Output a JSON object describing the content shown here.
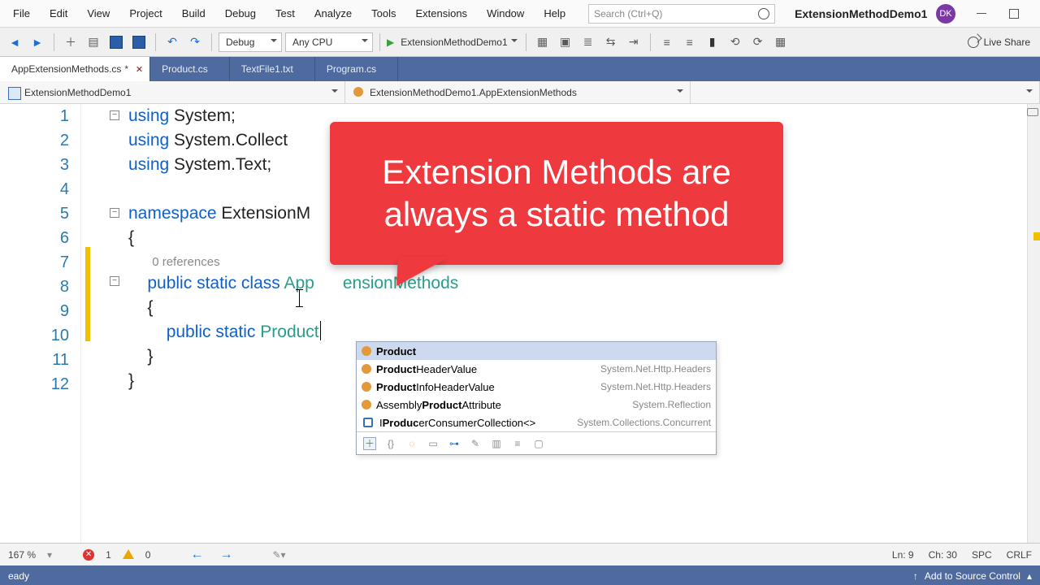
{
  "menu": [
    "File",
    "Edit",
    "View",
    "Project",
    "Build",
    "Debug",
    "Test",
    "Analyze",
    "Tools",
    "Extensions",
    "Window",
    "Help"
  ],
  "search_placeholder": "Search (Ctrl+Q)",
  "project_name": "ExtensionMethodDemo1",
  "avatar": "DK",
  "toolbar": {
    "config": "Debug",
    "platform": "Any CPU",
    "run_target": "ExtensionMethodDemo1",
    "live_share": "Live Share"
  },
  "tabs": [
    {
      "label": "AppExtensionMethods.cs",
      "dirty": true,
      "active": true
    },
    {
      "label": "Product.cs",
      "dirty": false,
      "active": false
    },
    {
      "label": "TextFile1.txt",
      "dirty": false,
      "active": false
    },
    {
      "label": "Program.cs",
      "dirty": false,
      "active": false
    }
  ],
  "scopes": {
    "project": "ExtensionMethodDemo1",
    "class": "ExtensionMethodDemo1.AppExtensionMethods"
  },
  "code": {
    "references_label": "0 references",
    "typed": "Product",
    "class_name_vis": "App      ensionMethods",
    "ns_vis": "ExtensionM"
  },
  "intellisense": {
    "items": [
      {
        "kind": "class",
        "html": "<b>Product</b>",
        "ns": ""
      },
      {
        "kind": "class",
        "html": "<b>Product</b>HeaderValue",
        "ns": "System.Net.Http.Headers"
      },
      {
        "kind": "class",
        "html": "<b>Product</b>InfoHeaderValue",
        "ns": "System.Net.Http.Headers"
      },
      {
        "kind": "class",
        "html": "Assembly<b>Product</b>Attribute",
        "ns": "System.Reflection"
      },
      {
        "kind": "iface",
        "html": "I<b>Produc</b>erConsumerCollection&lt;&gt;",
        "ns": "System.Collections.Concurrent"
      }
    ]
  },
  "bubble_text": "Extension Methods are always a static method",
  "bottom": {
    "zoom": "167 %",
    "errors": "1",
    "warnings": "0",
    "ln": "Ln: 9",
    "ch": "Ch: 30",
    "spc": "SPC",
    "crlf": "CRLF"
  },
  "status": {
    "ready": "eady",
    "source_control": "Add to Source Control"
  }
}
